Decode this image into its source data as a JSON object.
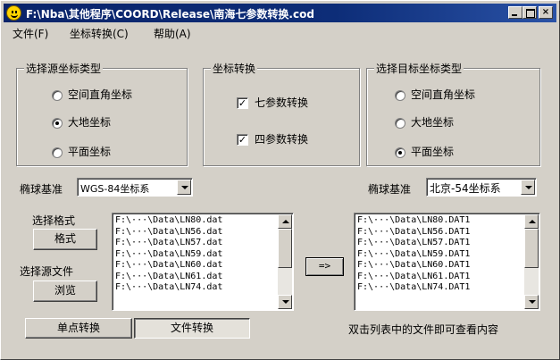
{
  "window": {
    "title": "F:\\Nba\\其他程序\\COORD\\Release\\南海七参数转换.cod",
    "min_label": "",
    "max_label": "",
    "close_label": "×"
  },
  "menu": [
    "文件(F)",
    "坐标转换(C)",
    "帮助(A)"
  ],
  "source_group": {
    "title": "选择源坐标类型",
    "options": [
      "空间直角坐标",
      "大地坐标",
      "平面坐标"
    ],
    "selected_index": 1
  },
  "transform_group": {
    "title": "坐标转换",
    "options": [
      "七参数转换",
      "四参数转换"
    ],
    "checked": [
      true,
      true
    ]
  },
  "target_group": {
    "title": "选择目标坐标类型",
    "options": [
      "空间直角坐标",
      "大地坐标",
      "平面坐标"
    ],
    "selected_index": 2
  },
  "source_ellipsoid": {
    "label": "椭球基准",
    "value": "WGS-84坐标系"
  },
  "target_ellipsoid": {
    "label": "椭球基准",
    "value": "北京-54坐标系"
  },
  "format_label": "选择格式",
  "format_button": "格式",
  "source_file_label": "选择源文件",
  "browse_button": "浏览",
  "source_files": [
    "F:\\···\\Data\\LN80.dat",
    "F:\\···\\Data\\LN56.dat",
    "F:\\···\\Data\\LN57.dat",
    "F:\\···\\Data\\LN59.dat",
    "F:\\···\\Data\\LN60.dat",
    "F:\\···\\Data\\LN61.dat",
    "F:\\···\\Data\\LN74.dat"
  ],
  "arrow_button": "=>",
  "target_files": [
    "F:\\···\\Data\\LN80.DAT1",
    "F:\\···\\Data\\LN56.DAT1",
    "F:\\···\\Data\\LN57.DAT1",
    "F:\\···\\Data\\LN59.DAT1",
    "F:\\···\\Data\\LN60.DAT1",
    "F:\\···\\Data\\LN61.DAT1",
    "F:\\···\\Data\\LN74.DAT1"
  ],
  "single_point_button": "单点转换",
  "file_convert_button": "文件转换",
  "hint": "双击列表中的文件即可查看内容"
}
